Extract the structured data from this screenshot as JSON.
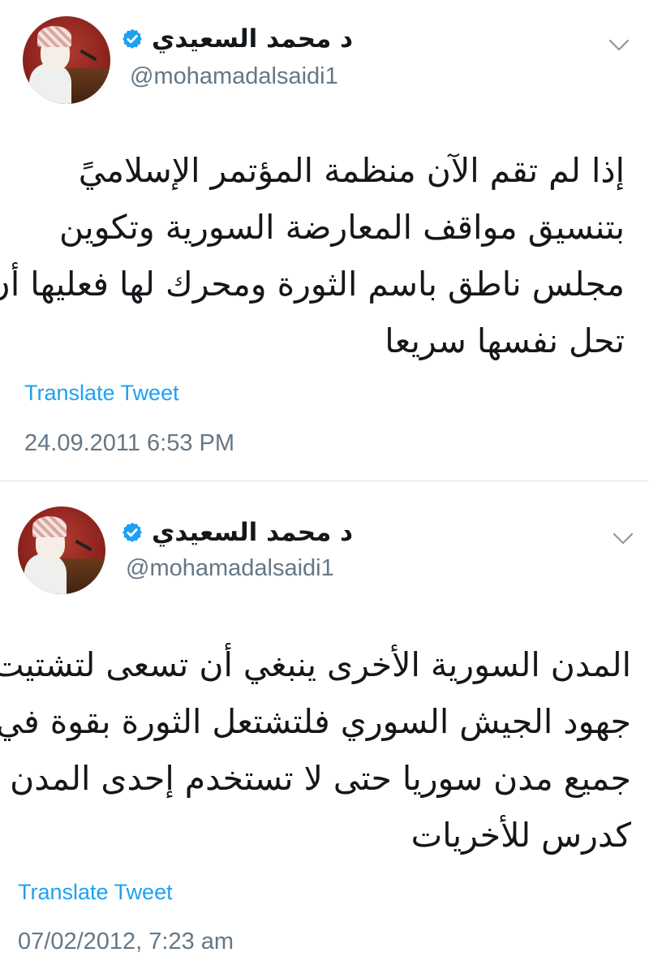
{
  "tweets": [
    {
      "author_name": "د محمد السعيدي",
      "handle": "@mohamadalsaidi1",
      "body_lines": [
        "إذا لم تقم الآن منظمة المؤتمر الإسلاميً",
        "بتنسيق مواقف المعارضة السورية وتكوين",
        "مجلس ناطق باسم الثورة ومحرك لها فعليها أن",
        "تحل نفسها سريعا"
      ],
      "translate_label": "Translate Tweet",
      "timestamp": "24.09.2011 6:53 PM"
    },
    {
      "author_name": "د محمد السعيدي",
      "handle": "@mohamadalsaidi1",
      "body_lines": [
        "المدن السورية الأخرى ينبغي أن تسعى لتشتيت",
        "جهود الجيش السوري فلتشتعل الثورة بقوة في",
        "جميع مدن سوريا حتى لا تستخدم إحدى المدن",
        "كدرس للأخريات"
      ],
      "translate_label": "Translate Tweet",
      "timestamp": "07/02/2012, 7:23 am"
    }
  ],
  "icons": {
    "verified": "verified-badge-icon",
    "menu": "chevron-down-icon"
  },
  "colors": {
    "link": "#1da1f2",
    "verified": "#1da1f2",
    "secondary_text": "#657786",
    "divider": "#e1e8ed"
  }
}
